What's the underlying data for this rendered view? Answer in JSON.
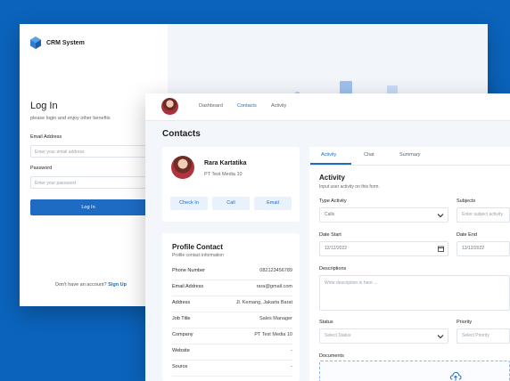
{
  "login": {
    "brand_name": "CRM System",
    "title": "Log In",
    "subtitle": "please login and enjoy other benefits",
    "email_label": "Email Address",
    "email_placeholder": "Enter your email address",
    "password_label": "Password",
    "password_placeholder": "Enter your password",
    "button_label": "Log In",
    "signup_prompt": "Don't have an account?",
    "signup_link": "Sign Up"
  },
  "nav": {
    "items": [
      "Dashboard",
      "Contacts",
      "Activity"
    ],
    "active": "Contacts"
  },
  "page": {
    "title": "Contacts"
  },
  "profile": {
    "name": "Rara Kartatika",
    "company": "PT Test Media 10",
    "actions": [
      "Check In",
      "Call",
      "Email"
    ]
  },
  "profile_contact": {
    "title": "Profile Contact",
    "subtitle": "Profile contact information",
    "rows": [
      {
        "key": "Phone Number",
        "value": "082123456789"
      },
      {
        "key": "Email Address",
        "value": "rara@gmail.com"
      },
      {
        "key": "Address",
        "value": "Jl. Kemang, Jakarta Barat"
      },
      {
        "key": "Job Title",
        "value": "Sales Manager"
      },
      {
        "key": "Company",
        "value": "PT Test Media 10"
      },
      {
        "key": "Website",
        "value": "-"
      },
      {
        "key": "Source",
        "value": "-"
      }
    ]
  },
  "activity": {
    "tabs": [
      "Activity",
      "Chat",
      "Summary"
    ],
    "active_tab": "Activity",
    "title": "Activity",
    "subtitle": "Input user activity on this form.",
    "type_label": "Type Activity",
    "type_value": "Calls",
    "subjects_label": "Subjects",
    "subjects_placeholder": "Enter subject activity",
    "date_start_label": "Date Start",
    "date_start_value": "12/12/2022",
    "date_end_label": "Date End",
    "date_end_value": "12/12/2022",
    "descriptions_label": "Descriptions",
    "descriptions_placeholder": "Write description in here ...",
    "status_label": "Status",
    "status_placeholder": "Select Status",
    "priority_label": "Priority",
    "priority_placeholder": "Select Priority",
    "documents_label": "Documents"
  },
  "colors": {
    "background": "#0b63bb",
    "accent": "#1e6bc4",
    "soft_accent": "#e8f1fc"
  },
  "icons": {
    "brand": "cube-logo-icon",
    "dropdown": "chevron-down-icon",
    "calendar": "calendar-icon",
    "upload": "cloud-upload-icon"
  }
}
